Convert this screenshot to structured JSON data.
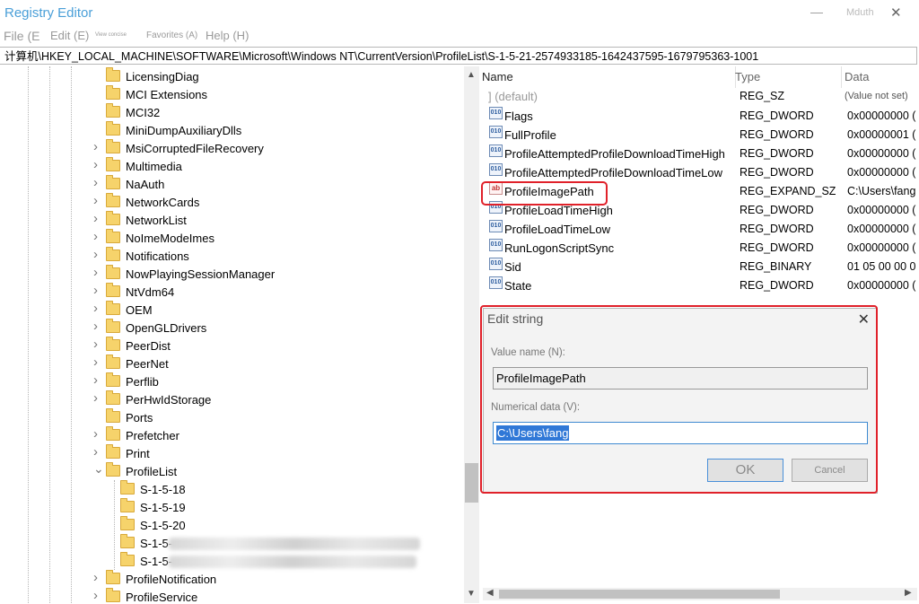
{
  "window": {
    "title": "Registry Editor",
    "minimize_glyph": "—",
    "right_title_text": "Mduth",
    "close_glyph": "✕"
  },
  "menu": [
    {
      "label": "File (E"
    },
    {
      "label": "Edit (E)"
    },
    {
      "label": "View concise"
    },
    {
      "label": "Favorites (A)"
    },
    {
      "label": "Help (H)"
    }
  ],
  "address": "计算机\\HKEY_LOCAL_MACHINE\\SOFTWARE\\Microsoft\\Windows NT\\CurrentVersion\\ProfileList\\S-1-5-21-2574933185-1642437595-1679795363-1001",
  "tree": {
    "items": [
      {
        "label": "LicensingDiag",
        "chev": ""
      },
      {
        "label": "MCI Extensions",
        "chev": ""
      },
      {
        "label": "MCI32",
        "chev": ""
      },
      {
        "label": "MiniDumpAuxiliaryDlls",
        "chev": ""
      },
      {
        "label": "MsiCorruptedFileRecovery",
        "chev": "›"
      },
      {
        "label": "Multimedia",
        "chev": "›"
      },
      {
        "label": "NaAuth",
        "chev": "›"
      },
      {
        "label": "NetworkCards",
        "chev": "›"
      },
      {
        "label": "NetworkList",
        "chev": "›"
      },
      {
        "label": "NoImeModeImes",
        "chev": "›"
      },
      {
        "label": "Notifications",
        "chev": "›"
      },
      {
        "label": "NowPlayingSessionManager",
        "chev": "›"
      },
      {
        "label": "NtVdm64",
        "chev": "›"
      },
      {
        "label": "OEM",
        "chev": "›"
      },
      {
        "label": "OpenGLDrivers",
        "chev": "›"
      },
      {
        "label": "PeerDist",
        "chev": "›"
      },
      {
        "label": "PeerNet",
        "chev": "›"
      },
      {
        "label": "Perflib",
        "chev": "›"
      },
      {
        "label": "PerHwIdStorage",
        "chev": "›"
      },
      {
        "label": "Ports",
        "chev": ""
      },
      {
        "label": "Prefetcher",
        "chev": "›"
      },
      {
        "label": "Print",
        "chev": "›"
      },
      {
        "label": "ProfileList",
        "chev": "⌄"
      }
    ],
    "children": [
      {
        "label": "S-1-5-18"
      },
      {
        "label": "S-1-5-19"
      },
      {
        "label": "S-1-5-20"
      },
      {
        "label": "S-1-5-"
      },
      {
        "label": "S-1-5-"
      }
    ],
    "after": [
      {
        "label": "ProfileNotification",
        "chev": "›"
      },
      {
        "label": "ProfileService",
        "chev": "›"
      }
    ]
  },
  "list": {
    "headers": {
      "name": "Name",
      "type": "Type",
      "data": "Data"
    },
    "rows": [
      {
        "icon": "default",
        "name": "] (default)",
        "type": "REG_SZ",
        "data": "(Value not set)"
      },
      {
        "icon": "bin",
        "name": "Flags",
        "type": "REG_DWORD",
        "data": "0x00000000 ("
      },
      {
        "icon": "bin",
        "name": "FullProfile",
        "type": "REG_DWORD",
        "data": "0x00000001 ("
      },
      {
        "icon": "bin",
        "name": "ProfileAttemptedProfileDownloadTimeHigh",
        "type": "REG_DWORD",
        "data": "0x00000000 ("
      },
      {
        "icon": "bin",
        "name": "ProfileAttemptedProfileDownloadTimeLow",
        "type": "REG_DWORD",
        "data": "0x00000000 ("
      },
      {
        "icon": "ab",
        "name": "ProfileImagePath",
        "type": "REG_EXPAND_SZ",
        "data": "C:\\Users\\fang"
      },
      {
        "icon": "bin",
        "name": "ProfileLoadTimeHigh",
        "type": "REG_DWORD",
        "data": "0x00000000 ("
      },
      {
        "icon": "bin",
        "name": "ProfileLoadTimeLow",
        "type": "REG_DWORD",
        "data": "0x00000000 ("
      },
      {
        "icon": "bin",
        "name": "RunLogonScriptSync",
        "type": "REG_DWORD",
        "data": "0x00000000 ("
      },
      {
        "icon": "bin",
        "name": "Sid",
        "type": "REG_BINARY",
        "data": "01 05 00 00 0"
      },
      {
        "icon": "bin",
        "name": "State",
        "type": "REG_DWORD",
        "data": "0x00000000 ("
      }
    ]
  },
  "dialog": {
    "title": "Edit string",
    "close_glyph": "✕",
    "value_name_label": "Value name (N):",
    "value_name": "ProfileImagePath",
    "data_label": "Numerical data (V):",
    "data_value": "C:\\Users\\fang",
    "ok_label": "OK",
    "cancel_label": "Cancel"
  },
  "icons": {
    "bin_glyph": "010",
    "ab_glyph": "ab"
  },
  "colors": {
    "title": "#4a9fd8",
    "highlight": "#e0212a",
    "selection": "#3078d7"
  }
}
